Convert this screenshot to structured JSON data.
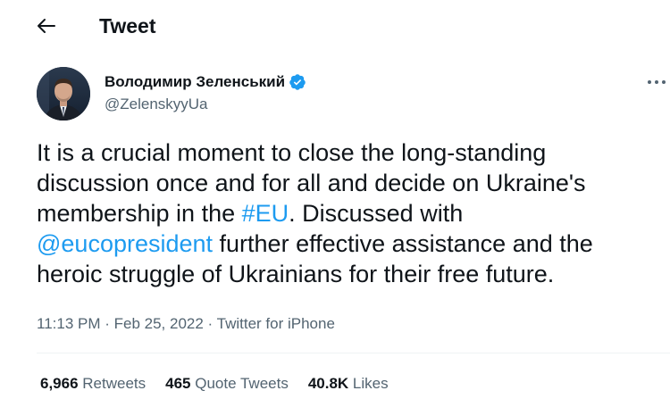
{
  "header": {
    "title": "Tweet"
  },
  "author": {
    "name": "Володимир Зеленський",
    "handle": "@ZelenskyyUa",
    "verified": true
  },
  "tweet": {
    "line1": "It is a crucial moment to close the long-standing",
    "line2": "discussion once and for all and decide on Ukraine's",
    "line3_pre": "membership in the ",
    "hashtag": "#EU",
    "line3_post": ". Discussed with",
    "mention": "@eucopresident",
    "line4_post": " further effective assistance and the",
    "line5": "heroic struggle of Ukrainians for their free future."
  },
  "meta": {
    "time": "11:13 PM",
    "sep1": " · ",
    "date": "Feb 25, 2022",
    "sep2": " · ",
    "source": "Twitter for iPhone"
  },
  "stats": {
    "retweets_count": "6,966",
    "retweets_label": " Retweets",
    "quotes_count": "465",
    "quotes_label": " Quote Tweets",
    "likes_count": "40.8K",
    "likes_label": " Likes"
  },
  "colors": {
    "link": "#1d9bf0",
    "text": "#0f1419",
    "secondary": "#536471",
    "verified": "#1d9bf0"
  },
  "icons": {
    "back": "arrow-left-icon",
    "verified": "verified-badge-icon",
    "more": "more-horizontal-icon"
  }
}
